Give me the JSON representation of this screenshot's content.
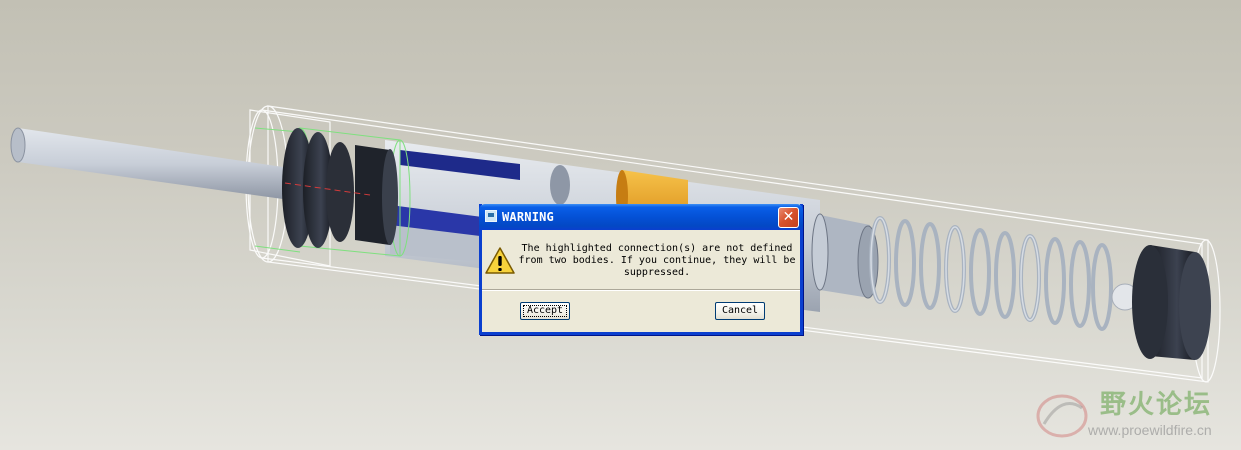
{
  "dialog": {
    "title": "WARNING",
    "close_symbol": "✕",
    "message": "The highlighted connection(s) are not defined\nfrom two bodies. If you continue, they will be\nsuppressed.",
    "accept_label": "Accept",
    "cancel_label": "Cancel",
    "icon": "warning-triangle-icon"
  },
  "watermark": {
    "site_name": "野火论坛",
    "url": "www.proewildfire.cn"
  },
  "colors": {
    "titlebar": "#0451d6",
    "dialog_bg": "#ece9d8",
    "spring": "#b8c2cf",
    "orange_part": "#e8a22a",
    "highlight": "#7fe07f"
  }
}
